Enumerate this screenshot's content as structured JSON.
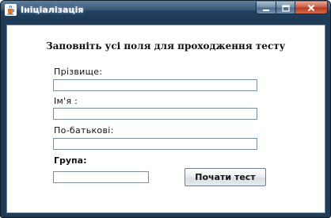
{
  "window": {
    "title": "Ініціалізація",
    "icon": "java-cup-icon",
    "controls": [
      "minimize-icon",
      "maximize-icon",
      "close-icon"
    ]
  },
  "form": {
    "heading": "Заповніть усі поля для проходження тесту",
    "fields": [
      {
        "label": "Прізвище:",
        "value": ""
      },
      {
        "label": "Ім'я :",
        "value": ""
      },
      {
        "label": "По-батькові:",
        "value": ""
      },
      {
        "label": "Група:",
        "value": ""
      }
    ],
    "start_button": "Почати тест"
  },
  "colors": {
    "titlebar": "#2b4968",
    "frame": "#1f3b55",
    "close_button": "#c8573f",
    "field_border": "#7a8ea6"
  }
}
